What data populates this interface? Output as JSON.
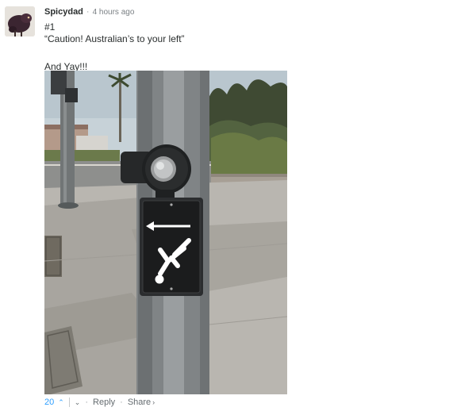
{
  "comment": {
    "author": "Spicydad",
    "separator": "·",
    "timestamp": "4 hours ago",
    "lines": [
      "#1",
      "“Caution! Australian’s to your left”",
      "And Yay!!!"
    ]
  },
  "footer": {
    "upvotes": "20",
    "up_icon": "⌃",
    "down_icon": "⌄",
    "dot1": "·",
    "reply_label": "Reply",
    "dot2": "·",
    "share_label": "Share",
    "share_icon": "›"
  },
  "colors": {
    "accent": "#2e9fff",
    "text": "#2a2e2e",
    "muted": "#656c70"
  }
}
